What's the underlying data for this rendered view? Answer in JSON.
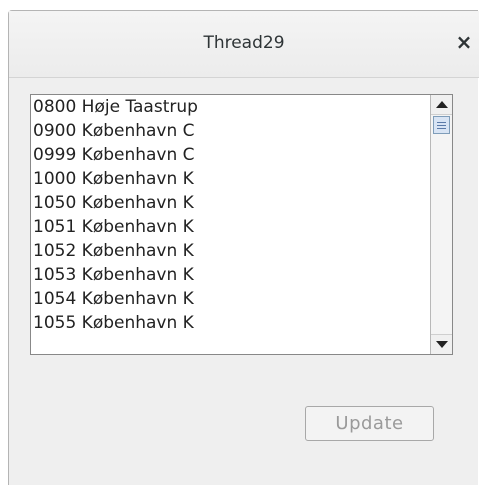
{
  "window": {
    "title": "Thread29",
    "close_glyph": "×"
  },
  "list": {
    "items": [
      "0800 Høje Taastrup",
      "0900 København C",
      "0999 København C",
      "1000 København K",
      "1050 København K",
      "1051 København K",
      "1052 København K",
      "1053 København K",
      "1054 København K",
      "1055 København K"
    ]
  },
  "update_button": {
    "label": "Update",
    "enabled": false
  }
}
